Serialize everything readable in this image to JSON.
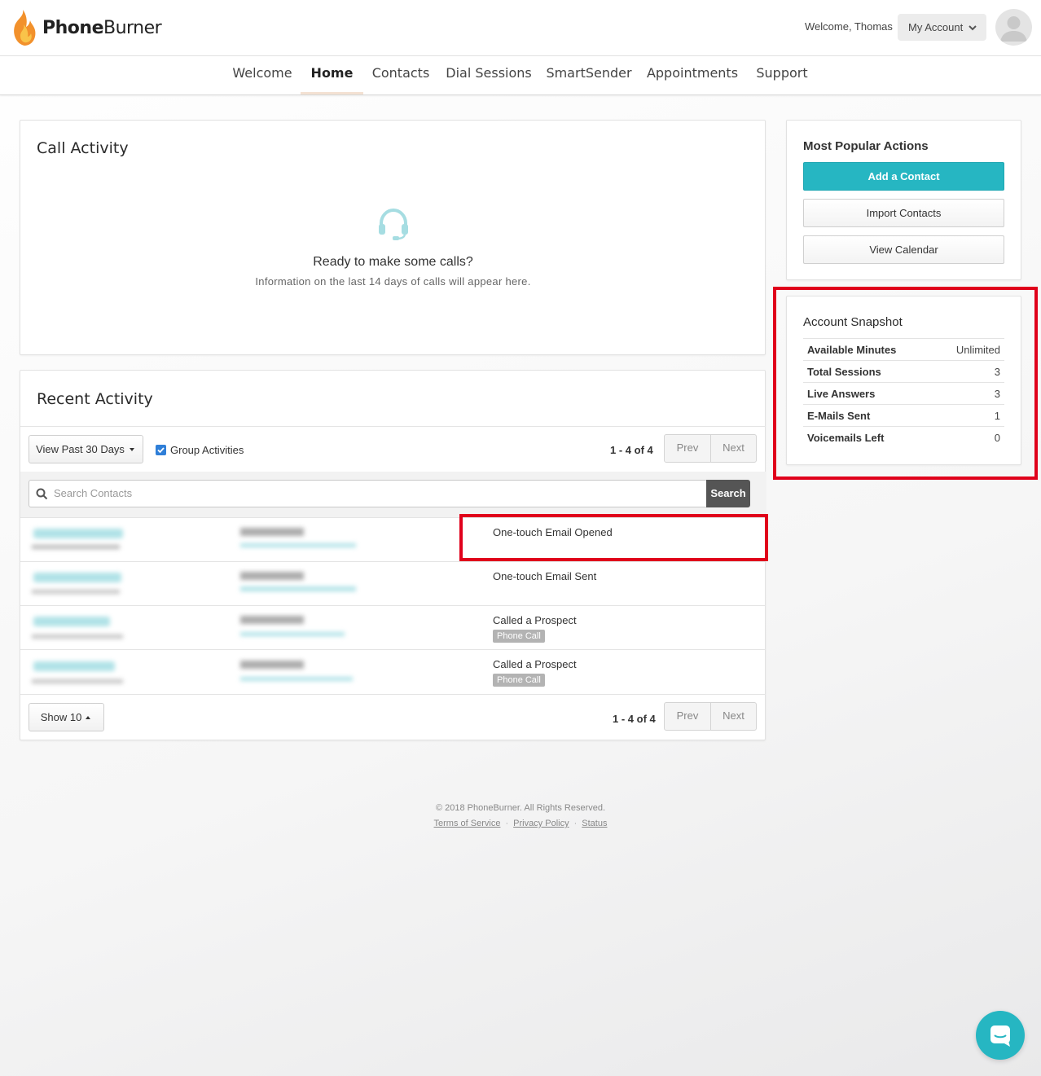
{
  "app": {
    "brand_bold": "Phone",
    "brand_light": "Burner"
  },
  "header": {
    "welcome": "Welcome, Thomas",
    "account_button": "My Account"
  },
  "nav": [
    {
      "label": "Welcome"
    },
    {
      "label": "Home",
      "active": true
    },
    {
      "label": "Contacts"
    },
    {
      "label": "Dial Sessions"
    },
    {
      "label": "SmartSender"
    },
    {
      "label": "Appointments"
    },
    {
      "label": "Support"
    }
  ],
  "call_activity": {
    "title": "Call Activity",
    "empty_heading": "Ready to make some calls?",
    "empty_text": "Information on the last 14 days of calls will appear here."
  },
  "recent_activity": {
    "title": "Recent Activity",
    "range_button": "View Past 30 Days",
    "group_activities_label": "Group Activities",
    "group_activities_checked": true,
    "count_top": "1 - 4 of 4",
    "prev": "Prev",
    "next": "Next",
    "search_placeholder": "Search Contacts",
    "search_button": "Search",
    "rows": [
      {
        "activity": "One-touch Email Opened",
        "tag": ""
      },
      {
        "activity": "One-touch Email Sent",
        "tag": ""
      },
      {
        "activity": "Called a Prospect",
        "tag": "Phone Call"
      },
      {
        "activity": "Called a Prospect",
        "tag": "Phone Call"
      }
    ],
    "show_button": "Show 10",
    "count_bottom": "1 - 4 of 4"
  },
  "popular_actions": {
    "title": "Most Popular Actions",
    "add_contact": "Add a Contact",
    "import_contacts": "Import Contacts",
    "view_calendar": "View Calendar"
  },
  "account_snapshot": {
    "title": "Account Snapshot",
    "rows": [
      {
        "label": "Available Minutes",
        "value": "Unlimited"
      },
      {
        "label": "Total Sessions",
        "value": "3"
      },
      {
        "label": "Live Answers",
        "value": "3"
      },
      {
        "label": "E-Mails Sent",
        "value": "1"
      },
      {
        "label": "Voicemails Left",
        "value": "0"
      }
    ]
  },
  "footer": {
    "copyright": "© 2018 PhoneBurner. All Rights Reserved.",
    "terms": "Terms of Service",
    "privacy": "Privacy Policy",
    "status": "Status"
  },
  "colors": {
    "accent": "#26b6c2",
    "highlight": "#e0001b"
  },
  "icons": [
    "flame-logo-icon",
    "chevron-down-icon",
    "user-avatar-icon",
    "headset-icon",
    "search-icon",
    "checkbox-icon",
    "caret-down-icon",
    "caret-up-icon",
    "chat-icon"
  ]
}
